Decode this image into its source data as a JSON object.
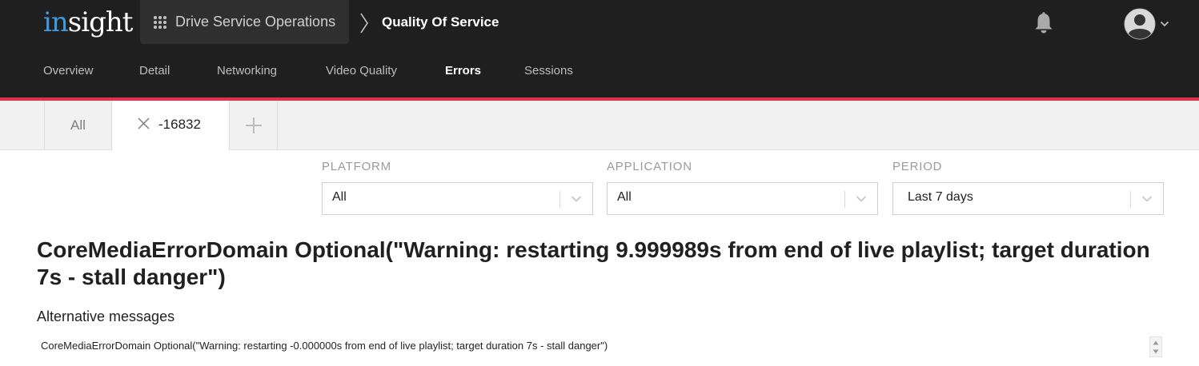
{
  "header": {
    "logo_part1": "in",
    "logo_part2": "sight",
    "service_label": "Drive Service Operations",
    "breadcrumb_current": "Quality Of Service",
    "icons": {
      "apps": "grid-icon",
      "notifications": "bell-icon",
      "user": "avatar-icon",
      "menu": "chevron-down-icon"
    }
  },
  "nav": {
    "items": [
      {
        "label": "Overview"
      },
      {
        "label": "Detail"
      },
      {
        "label": "Networking"
      },
      {
        "label": "Video Quality"
      },
      {
        "label": "Errors",
        "active": true
      },
      {
        "label": "Sessions"
      }
    ]
  },
  "filter_tabs": {
    "all_label": "All",
    "active_label": "-16832",
    "add_icon": "plus-icon",
    "close_icon": "close-icon"
  },
  "filters": {
    "platform": {
      "label": "PLATFORM",
      "value": "All"
    },
    "application": {
      "label": "APPLICATION",
      "value": "All"
    },
    "period": {
      "label": "PERIOD",
      "value": "Last 7 days"
    }
  },
  "content": {
    "error_title": "CoreMediaErrorDomain Optional(\"Warning: restarting 9.999989s from end of live playlist; target duration 7s - stall danger\")",
    "alternative_heading": "Alternative messages",
    "alternative_messages": [
      "CoreMediaErrorDomain Optional(\"Warning: restarting -0.000000s from end of live playlist; target duration 7s - stall danger\")"
    ]
  },
  "colors": {
    "header_bg": "#1f1f1f",
    "accent": "#e3304d",
    "logo_blue": "#3f9be0",
    "tabbar_bg": "#f1f1f1"
  }
}
